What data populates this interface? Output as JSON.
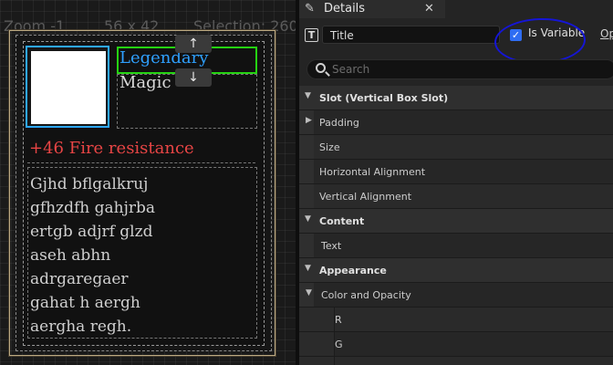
{
  "viewport": {
    "zoom": "Zoom -1",
    "size": "56 x 42",
    "selection": "Selection: 260",
    "move_up": "↑",
    "move_down": "↓",
    "tooltip": {
      "title": "Legendary",
      "subtitle": "Magic",
      "stat": "+46 Fire resistance",
      "description": "Gjhd bflgalkruj\ngfhzdfh gahjrba\nertgb adjrf glzd\naseh abhn\nadrgaregaer\ngahat h aergh\naergha regh."
    }
  },
  "details": {
    "tab_label": "Details",
    "widget_name": "Title",
    "is_variable_label": "Is Variable",
    "is_variable_checked": true,
    "more_option": "Op",
    "search_placeholder": "Search",
    "rows": {
      "slot_category": "Slot (Vertical Box Slot)",
      "padding": "Padding",
      "size": "Size",
      "horizontal_alignment": "Horizontal Alignment",
      "vertical_alignment": "Vertical Alignment",
      "content_category": "Content",
      "text": "Text",
      "appearance_category": "Appearance",
      "color_and_opacity": "Color and Opacity",
      "r": "R",
      "g": "G"
    }
  },
  "colors": {
    "title_color": "#2fa0ff",
    "stat_color": "#e84545",
    "selection_green": "#25d312",
    "selection_blue": "#2ea8ff",
    "checkbox_blue": "#2f6df2"
  }
}
